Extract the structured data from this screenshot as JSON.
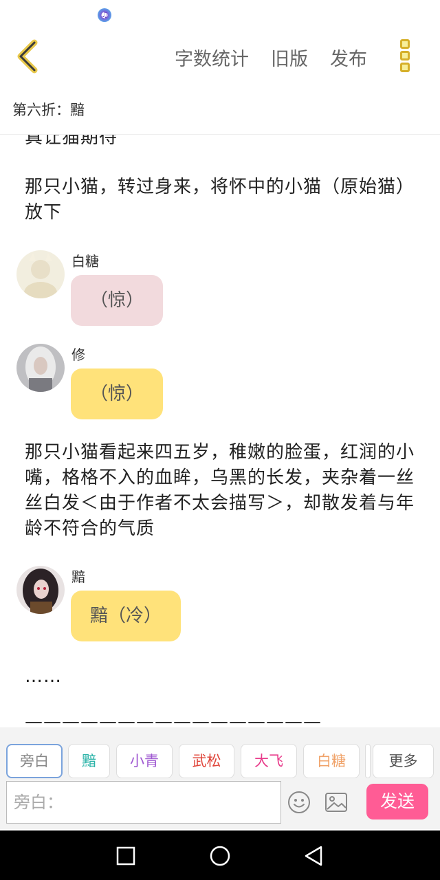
{
  "status_bar": {
    "icon": "music-app-icon"
  },
  "header": {
    "back_icon": "chevron-left-icon",
    "actions": [
      "字数统计",
      "旧版",
      "发布"
    ],
    "more_icon": "more-vertical-icon",
    "accent_color": "#d6b02a"
  },
  "chapter": {
    "title": "第六折：黯"
  },
  "content": {
    "cut_text": "真让猫期待",
    "paragraph_1": "那只小猫，转过身来，将怀中的小猫（原始猫）放下",
    "messages": [
      {
        "speaker": "白糖",
        "text": "（惊）",
        "bubble_color": "#f2dadd"
      },
      {
        "speaker": "修",
        "text": "（惊）",
        "bubble_color": "#ffe27a"
      },
      {
        "speaker": "黯",
        "text": "黯（冷）",
        "bubble_color": "#ffe27a"
      }
    ],
    "paragraph_2": "那只小猫看起来四五岁，稚嫩的脸蛋，红润的小嘴，格格不入的血眸，乌黑的长发，夹杂着一丝丝白发＜由于作者不太会描写＞，却散发着与年龄不符合的气质",
    "ellipsis": "……",
    "divider": "————————————————"
  },
  "characters": [
    {
      "label": "旁白",
      "color": "#888888"
    },
    {
      "label": "黯",
      "color": "#2bb3a8"
    },
    {
      "label": "小青",
      "color": "#a05ad2"
    },
    {
      "label": "武松",
      "color": "#e0453a"
    },
    {
      "label": "大飞",
      "color": "#e83a8a"
    },
    {
      "label": "白糖",
      "color": "#f0a36a"
    },
    {
      "label": "更多",
      "color": "#555555"
    }
  ],
  "composer": {
    "placeholder": "旁白：",
    "emoji_icon": "emoji-icon",
    "image_icon": "image-icon",
    "send_label": "发送",
    "send_color": "#ff5c95"
  },
  "nav_bar": {
    "recents_icon": "square-icon",
    "home_icon": "circle-icon",
    "back_icon": "triangle-back-icon"
  }
}
